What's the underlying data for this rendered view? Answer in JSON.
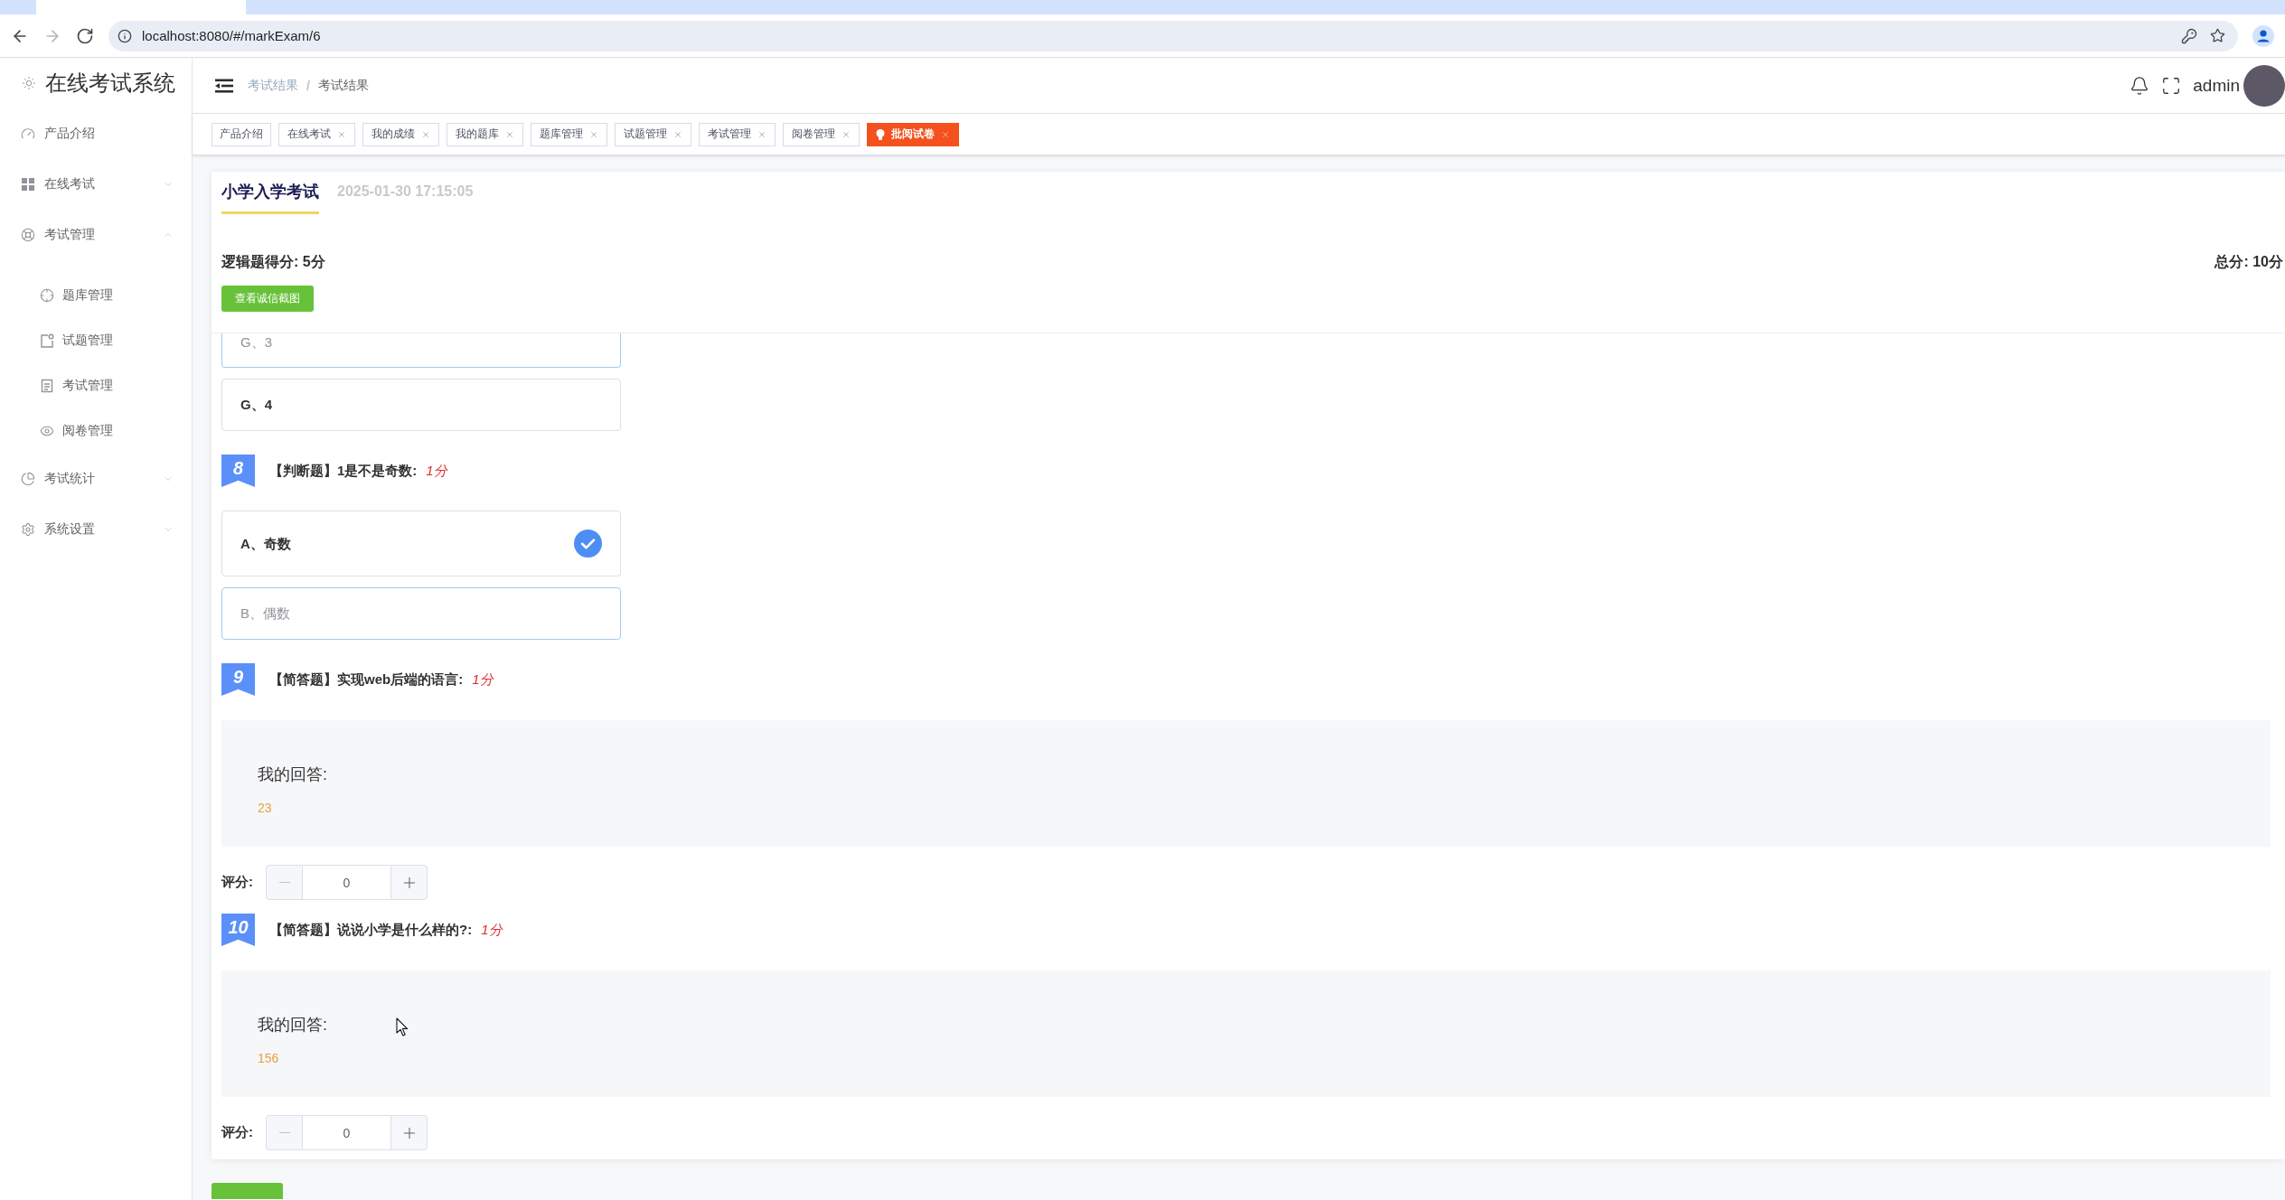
{
  "browser": {
    "url": "localhost:8080/#/markExam/6",
    "forward_disabled": true
  },
  "sidebar": {
    "title": "在线考试系统",
    "items": [
      {
        "label": "产品介绍",
        "selected": false
      },
      {
        "label": "在线考试",
        "selected": false,
        "expanded": false
      },
      {
        "label": "考试管理",
        "selected": false,
        "expanded": true,
        "children": [
          {
            "label": "题库管理",
            "selected": false
          },
          {
            "label": "试题管理",
            "selected": false
          },
          {
            "label": "考试管理",
            "selected": false
          },
          {
            "label": "阅卷管理",
            "selected": false
          }
        ]
      },
      {
        "label": "考试统计",
        "selected": false,
        "expanded": false
      },
      {
        "label": "系统设置",
        "selected": false,
        "expanded": false
      }
    ]
  },
  "header": {
    "breadcrumb": [
      "考试结果",
      "考试结果"
    ],
    "breadcrumb_separator": "/",
    "user": "admin"
  },
  "tabs": [
    {
      "label": "产品介绍",
      "closable": false,
      "selected": false
    },
    {
      "label": "在线考试",
      "closable": true,
      "selected": false
    },
    {
      "label": "我的成绩",
      "closable": true,
      "selected": false
    },
    {
      "label": "我的题库",
      "closable": true,
      "selected": false
    },
    {
      "label": "题库管理",
      "closable": true,
      "selected": false
    },
    {
      "label": "试题管理",
      "closable": true,
      "selected": false
    },
    {
      "label": "考试管理",
      "closable": true,
      "selected": false
    },
    {
      "label": "阅卷管理",
      "closable": true,
      "selected": false
    },
    {
      "label": "批阅试卷",
      "closable": true,
      "selected": true
    }
  ],
  "exam": {
    "title": "小学入学考试",
    "date": "2025-01-30 17:15:05",
    "logic_score": "逻辑题得分: 5分",
    "total_score": "总分: 10分",
    "screenshot_button": "查看诚信截图"
  },
  "questions": [
    {
      "kind": "choice",
      "options": [
        {
          "label": "G、3",
          "clipped": true,
          "highlighted": false,
          "selected": false
        },
        {
          "label": "G、4",
          "clipped": false,
          "highlighted": true,
          "selected": false
        }
      ]
    },
    {
      "kind": "choice",
      "number": "8",
      "prompt": "【判断题】1是不是奇数:",
      "points": "1分",
      "options": [
        {
          "label": "A、奇数",
          "clipped": false,
          "highlighted": true,
          "selected": true
        },
        {
          "label": "B、偶数",
          "clipped": false,
          "highlighted": false,
          "selected": false
        }
      ]
    },
    {
      "kind": "essay",
      "number": "9",
      "prompt": "【简答题】实现web后端的语言:",
      "points": "1分",
      "answer_label": "我的回答:",
      "answer": "23",
      "rating_label": "评分:",
      "rating": "0",
      "decrement_disabled": true
    },
    {
      "kind": "essay",
      "number": "10",
      "prompt": "【简答题】说说小学是什么样的?:",
      "points": "1分",
      "answer_label": "我的回答:",
      "answer": "156",
      "rating_label": "评分:",
      "rating": "0",
      "decrement_disabled": true
    }
  ],
  "footer_button": {
    "shown": true
  },
  "mouse_pointer": {
    "shown": true
  }
}
